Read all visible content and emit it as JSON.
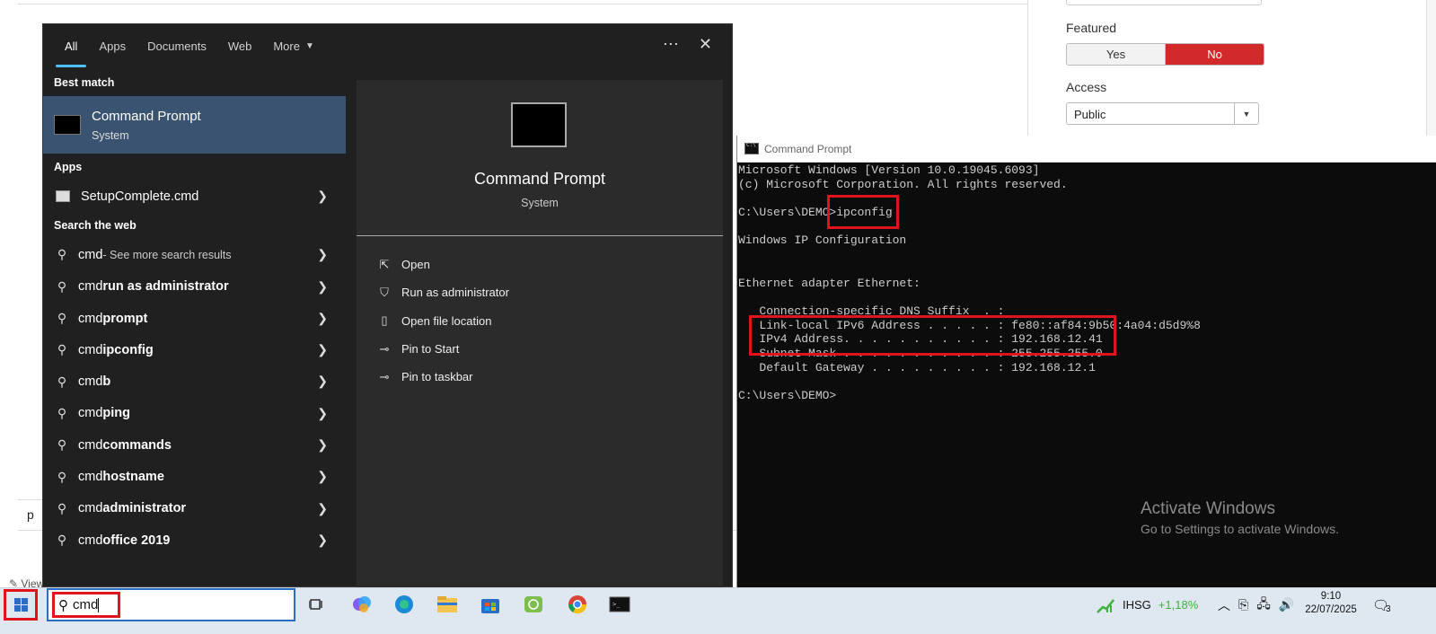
{
  "background": {
    "featured_label": "Featured",
    "featured_yes": "Yes",
    "featured_no": "No",
    "access_label": "Access",
    "access_value": "Public",
    "p_text": "p",
    "view_text": "View"
  },
  "search_menu": {
    "tabs": [
      "All",
      "Apps",
      "Documents",
      "Web",
      "More"
    ],
    "best_match_label": "Best match",
    "best_match": {
      "title": "Command Prompt",
      "subtitle": "System"
    },
    "apps_label": "Apps",
    "apps": [
      {
        "label": "SetupComplete.cmd"
      }
    ],
    "web_label": "Search the web",
    "web_results": [
      {
        "prefix": "cmd",
        "bold": "",
        "small": " - See more search results"
      },
      {
        "prefix": "cmd ",
        "bold": "run as administrator",
        "small": ""
      },
      {
        "prefix": "cmd ",
        "bold": "prompt",
        "small": ""
      },
      {
        "prefix": "cmd ",
        "bold": "ipconfig",
        "small": ""
      },
      {
        "prefix": "cmd",
        "bold": "b",
        "small": ""
      },
      {
        "prefix": "cmd ",
        "bold": "ping",
        "small": ""
      },
      {
        "prefix": "cmd ",
        "bold": "commands",
        "small": ""
      },
      {
        "prefix": "cmd ",
        "bold": "hostname",
        "small": ""
      },
      {
        "prefix": "cmd ",
        "bold": "administrator",
        "small": ""
      },
      {
        "prefix": "cmd ",
        "bold": "office 2019",
        "small": ""
      }
    ],
    "preview": {
      "title": "Command Prompt",
      "subtitle": "System"
    },
    "actions": [
      {
        "label": "Open",
        "icon": "open-icon"
      },
      {
        "label": "Run as administrator",
        "icon": "shield-icon"
      },
      {
        "label": "Open file location",
        "icon": "file-location-icon"
      },
      {
        "label": "Pin to Start",
        "icon": "pin-icon"
      },
      {
        "label": "Pin to taskbar",
        "icon": "pin-icon"
      }
    ]
  },
  "cmd_window": {
    "title": "Command Prompt",
    "lines": [
      "Microsoft Windows [Version 10.0.19045.6093]",
      "(c) Microsoft Corporation. All rights reserved.",
      "",
      "C:\\Users\\DEMO>ipconfig",
      "",
      "Windows IP Configuration",
      "",
      "",
      "Ethernet adapter Ethernet:",
      "",
      "   Connection-specific DNS Suffix  . :",
      "   Link-local IPv6 Address . . . . . : fe80::af84:9b50:4a04:d5d9%8",
      "   IPv4 Address. . . . . . . . . . . : 192.168.12.41",
      "   Subnet Mask . . . . . . . . . . . : 255.255.255.0",
      "   Default Gateway . . . . . . . . . : 192.168.12.1",
      "",
      "C:\\Users\\DEMO>"
    ],
    "watermark_title": "Activate Windows",
    "watermark_sub": "Go to Settings to activate Windows."
  },
  "taskbar": {
    "search_value": "cmd",
    "stock_name": "IHSG",
    "stock_change": "+1,18%",
    "time": "9:10",
    "date": "22/07/2025",
    "notification_count": "3"
  },
  "colors": {
    "accent_red": "#d22a2a",
    "highlight_red": "#e0141e",
    "selection_blue": "#3a5370",
    "stock_green": "#3fb13f"
  }
}
